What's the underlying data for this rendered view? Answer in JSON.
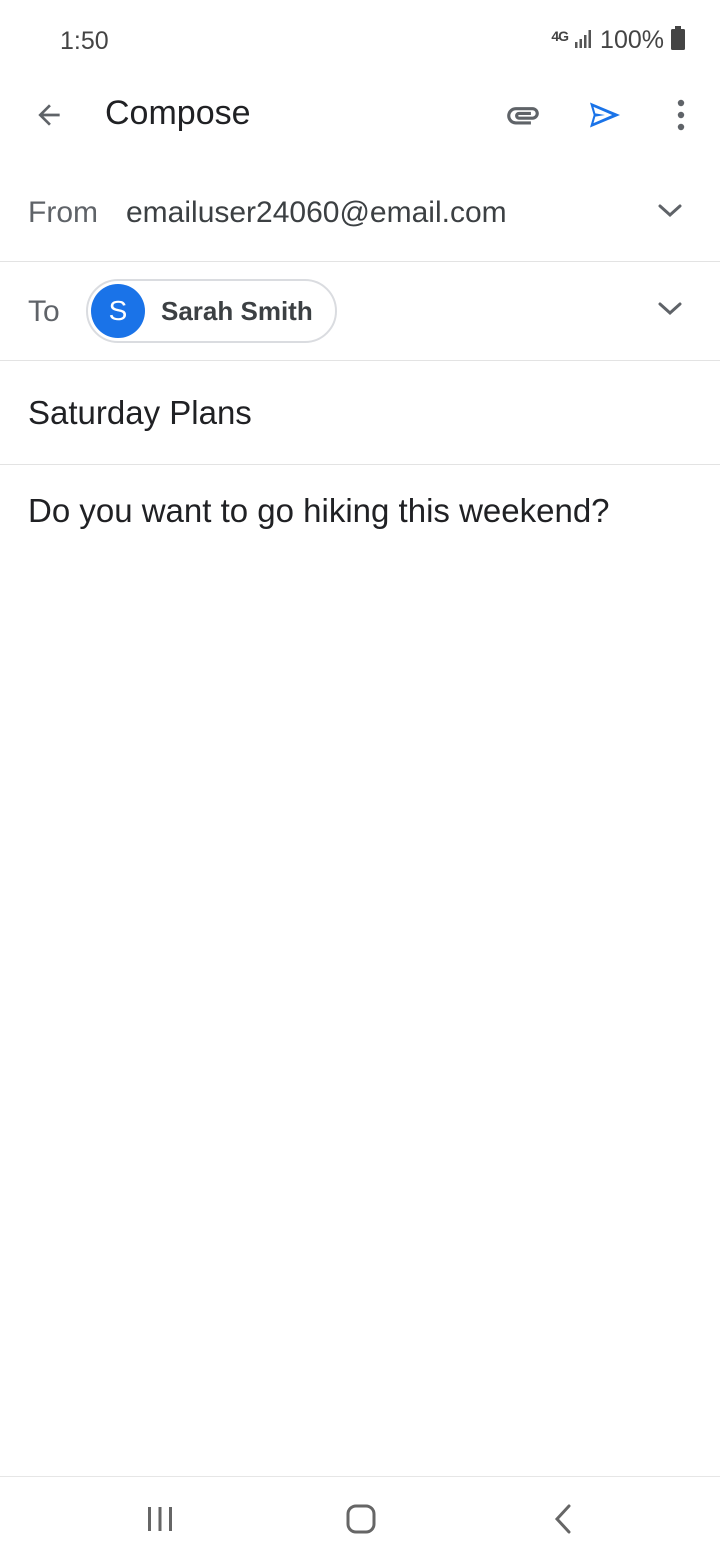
{
  "status_bar": {
    "time": "1:50",
    "network": "4G",
    "battery": "100%"
  },
  "app_bar": {
    "title": "Compose",
    "icons": [
      "back-arrow-icon",
      "paperclip-icon",
      "send-icon",
      "more-vert-icon"
    ]
  },
  "from": {
    "label": "From",
    "value": "emailuser24060@email.com"
  },
  "to": {
    "label": "To",
    "recipient_initial": "S",
    "recipient_name": "Sarah Smith"
  },
  "subject": "Saturday Plans",
  "body": "Do you want to go hiking this weekend?",
  "colors": {
    "accent": "#1a73e8",
    "text": "#202124",
    "secondary_text": "#5f6368",
    "divider": "#e3e3e3"
  }
}
